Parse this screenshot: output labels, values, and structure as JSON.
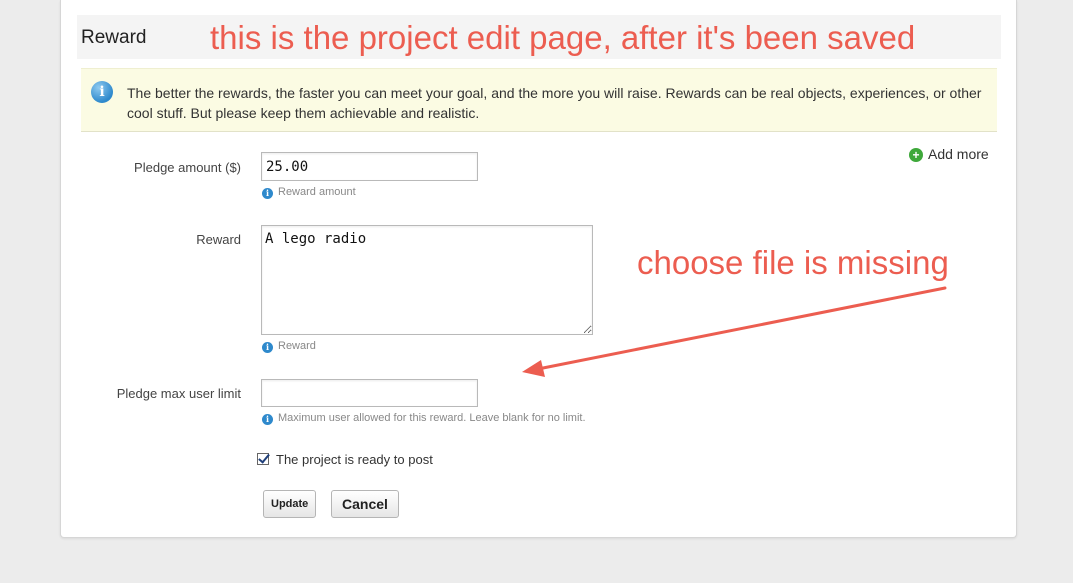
{
  "section": {
    "title": "Reward"
  },
  "info": {
    "icon": "info-icon",
    "text": "The better the rewards, the faster you can meet your goal, and the more you will raise. Rewards can be real objects, experiences, or other cool stuff. But please keep them achievable and realistic."
  },
  "add_more": {
    "label": "Add more",
    "icon": "plus-circle-icon"
  },
  "fields": {
    "pledge_amount": {
      "label": "Pledge amount ($)",
      "value": "25.00",
      "help": "Reward amount"
    },
    "reward": {
      "label": "Reward",
      "value": "A lego radio",
      "help": "Reward"
    },
    "max_users": {
      "label": "Pledge max user limit",
      "value": "",
      "help": "Maximum user allowed for this reward. Leave blank for no limit."
    }
  },
  "ready": {
    "label": "The project is ready to post",
    "checked": true
  },
  "buttons": {
    "update": "Update",
    "cancel": "Cancel"
  },
  "annotations": {
    "top": "this is the project edit page, after it's been saved",
    "missing": "choose file is missing",
    "color": "#ec5d50"
  }
}
